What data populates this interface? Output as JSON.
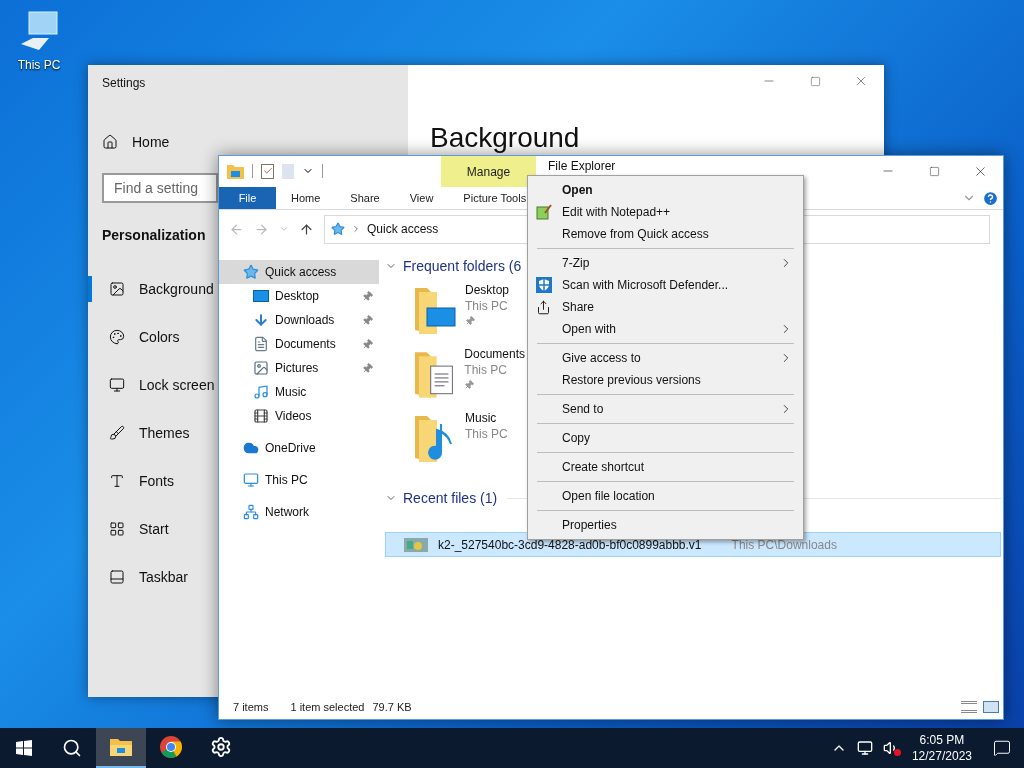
{
  "desktop_icons": [
    {
      "label": "This PC"
    }
  ],
  "settings": {
    "title": "Settings",
    "home": "Home",
    "search": {
      "placeholder": "Find a setting"
    },
    "section": "Personalization",
    "page_title": "Background",
    "nav": [
      {
        "label": "Background",
        "selected": true
      },
      {
        "label": "Colors",
        "selected": false
      },
      {
        "label": "Lock screen",
        "selected": false
      },
      {
        "label": "Themes",
        "selected": false
      },
      {
        "label": "Fonts",
        "selected": false
      },
      {
        "label": "Start",
        "selected": false
      },
      {
        "label": "Taskbar",
        "selected": false
      }
    ]
  },
  "explorer": {
    "title": "File Explorer",
    "context_tab": "Manage",
    "ribbon_tabs": [
      {
        "label": "File",
        "selected": true
      },
      {
        "label": "Home",
        "selected": false
      },
      {
        "label": "Share",
        "selected": false
      },
      {
        "label": "View",
        "selected": false
      },
      {
        "label": "Picture Tools",
        "selected": false
      }
    ],
    "address": "Quick access",
    "nav": [
      {
        "label": "Quick access",
        "selected": true,
        "children": [
          {
            "label": "Desktop",
            "pinned": true
          },
          {
            "label": "Downloads",
            "pinned": true
          },
          {
            "label": "Documents",
            "pinned": true
          },
          {
            "label": "Pictures",
            "pinned": true
          },
          {
            "label": "Music",
            "pinned": false
          },
          {
            "label": "Videos",
            "pinned": false
          }
        ]
      },
      {
        "label": "OneDrive",
        "selected": false
      },
      {
        "label": "This PC",
        "selected": false
      },
      {
        "label": "Network",
        "selected": false
      }
    ],
    "frequent_heading": "Frequent folders (6",
    "frequent": [
      {
        "name": "Desktop",
        "location": "This PC",
        "pinned": true
      },
      {
        "name": "Documents",
        "location": "This PC",
        "pinned": true
      },
      {
        "name": "Music",
        "location": "This PC",
        "pinned": false
      }
    ],
    "recent_heading": "Recent files (1)",
    "recent": [
      {
        "name": "k2-_527540bc-3cd9-4828-ad0b-bf0c0899abbb.v1",
        "location": "This PC\\Downloads",
        "selected": true
      }
    ],
    "status": [
      "7 items",
      "1 item selected",
      "79.7 KB"
    ]
  },
  "context_menu": [
    {
      "kind": "item",
      "label": "Open",
      "bold": true
    },
    {
      "kind": "item",
      "label": "Edit with Notepad++"
    },
    {
      "kind": "item",
      "label": "Remove from Quick access"
    },
    {
      "kind": "separator"
    },
    {
      "kind": "item",
      "label": "7-Zip",
      "submenu": true
    },
    {
      "kind": "item",
      "label": "Scan with Microsoft Defender..."
    },
    {
      "kind": "item",
      "label": "Share"
    },
    {
      "kind": "item",
      "label": "Open with",
      "submenu": true
    },
    {
      "kind": "separator"
    },
    {
      "kind": "item",
      "label": "Give access to",
      "submenu": true
    },
    {
      "kind": "item",
      "label": "Restore previous versions"
    },
    {
      "kind": "separator"
    },
    {
      "kind": "item",
      "label": "Send to",
      "submenu": true
    },
    {
      "kind": "separator"
    },
    {
      "kind": "item",
      "label": "Copy"
    },
    {
      "kind": "separator"
    },
    {
      "kind": "item",
      "label": "Create shortcut"
    },
    {
      "kind": "separator"
    },
    {
      "kind": "item",
      "label": "Open file location"
    },
    {
      "kind": "separator"
    },
    {
      "kind": "item",
      "label": "Properties"
    }
  ],
  "taskbar": {
    "apps": [
      {
        "selected": true
      },
      {
        "selected": false
      },
      {
        "selected": false
      }
    ],
    "time": "6:05 PM",
    "date": "12/27/2023"
  }
}
